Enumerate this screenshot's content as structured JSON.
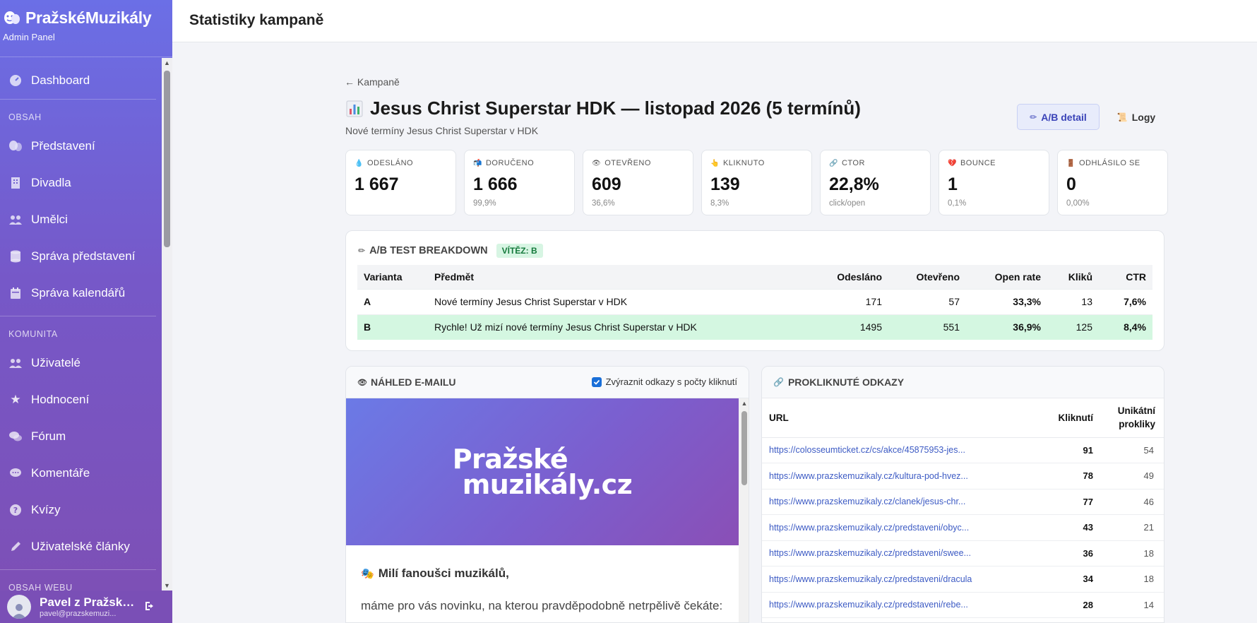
{
  "brand": {
    "title": "PražskéMuzikály",
    "subtitle": "Admin Panel"
  },
  "sidebar": {
    "dashboard": "Dashboard",
    "section_content": "OBSAH",
    "content_items": [
      "Představení",
      "Divadla",
      "Umělci",
      "Správa představení",
      "Správa kalendářů"
    ],
    "section_community": "KOMUNITA",
    "community_items": [
      "Uživatelé",
      "Hodnocení",
      "Fórum",
      "Komentáře",
      "Kvízy",
      "Uživatelské články"
    ],
    "section_web": "OBSAH WEBU"
  },
  "user": {
    "name": "Pavel z Pražských muzikálů",
    "email": "pavel@prazskemuzi..."
  },
  "topbar": {
    "title": "Statistiky kampaně"
  },
  "campaign": {
    "back_link": "← Kampaně",
    "title": "Jesus Christ Superstar HDK — listopad 2026 (5 termínů)",
    "subtitle": "Nové termíny Jesus Christ Superstar v HDK",
    "ab_button": "A/B detail",
    "logs_button": "Logy"
  },
  "stats": [
    {
      "icon": "💧",
      "label": "ODESLÁNO",
      "value": "1 667",
      "sub": ""
    },
    {
      "icon": "📬",
      "label": "DORUČENO",
      "value": "1 666",
      "sub": "99,9%"
    },
    {
      "icon": "👁",
      "label": "OTEVŘENO",
      "value": "609",
      "sub": "36,6%"
    },
    {
      "icon": "👆",
      "label": "KLIKNUTO",
      "value": "139",
      "sub": "8,3%"
    },
    {
      "icon": "🔗",
      "label": "CTOR",
      "value": "22,8%",
      "sub": "click/open"
    },
    {
      "icon": "💔",
      "label": "BOUNCE",
      "value": "1",
      "sub": "0,1%"
    },
    {
      "icon": "🚪",
      "label": "ODHLÁSILO SE",
      "value": "0",
      "sub": "0,00%"
    }
  ],
  "ab_test": {
    "title": "A/B TEST BREAKDOWN",
    "winner": "VÍTĚZ: B",
    "columns": [
      "Varianta",
      "Předmět",
      "Odesláno",
      "Otevřeno",
      "Open rate",
      "Kliků",
      "CTR"
    ],
    "rows": [
      {
        "variant": "A",
        "subject": "Nové termíny Jesus Christ Superstar v HDK",
        "sent": "171",
        "opened": "57",
        "open_rate": "33,3%",
        "clicks": "13",
        "ctr": "7,6%"
      },
      {
        "variant": "B",
        "subject": "Rychle! Už mizí nové termíny Jesus Christ Superstar v HDK",
        "sent": "1495",
        "opened": "551",
        "open_rate": "36,9%",
        "clicks": "125",
        "ctr": "8,4%"
      }
    ]
  },
  "preview": {
    "title": "NÁHLED E-MAILU",
    "highlight_label": "Zvýraznit odkazy s počty kliknutí",
    "highlight_checked": true,
    "banner_line1": "Pražské",
    "banner_line2": "muzikály.cz",
    "greeting": "Milí fanoušci muzikálů,",
    "body": "máme pro vás novinku, na kterou pravděpodobně netrpělivě čekáte:"
  },
  "links": {
    "title": "PROKLIKNUTÉ ODKAZY",
    "columns": [
      "URL",
      "Kliknutí",
      "Unikátní prokliky"
    ],
    "rows": [
      {
        "url": "https://colosseumticket.cz/cs/akce/45875953-jes...",
        "clicks": "91",
        "unique": "54"
      },
      {
        "url": "https://www.prazskemuzikaly.cz/kultura-pod-hvez...",
        "clicks": "78",
        "unique": "49"
      },
      {
        "url": "https://www.prazskemuzikaly.cz/clanek/jesus-chr...",
        "clicks": "77",
        "unique": "46"
      },
      {
        "url": "https://www.prazskemuzikaly.cz/predstaveni/obyc...",
        "clicks": "43",
        "unique": "21"
      },
      {
        "url": "https://www.prazskemuzikaly.cz/predstaveni/swee...",
        "clicks": "36",
        "unique": "18"
      },
      {
        "url": "https://www.prazskemuzikaly.cz/predstaveni/dracula",
        "clicks": "34",
        "unique": "18"
      },
      {
        "url": "https://www.prazskemuzikaly.cz/predstaveni/rebe...",
        "clicks": "28",
        "unique": "14"
      }
    ]
  }
}
